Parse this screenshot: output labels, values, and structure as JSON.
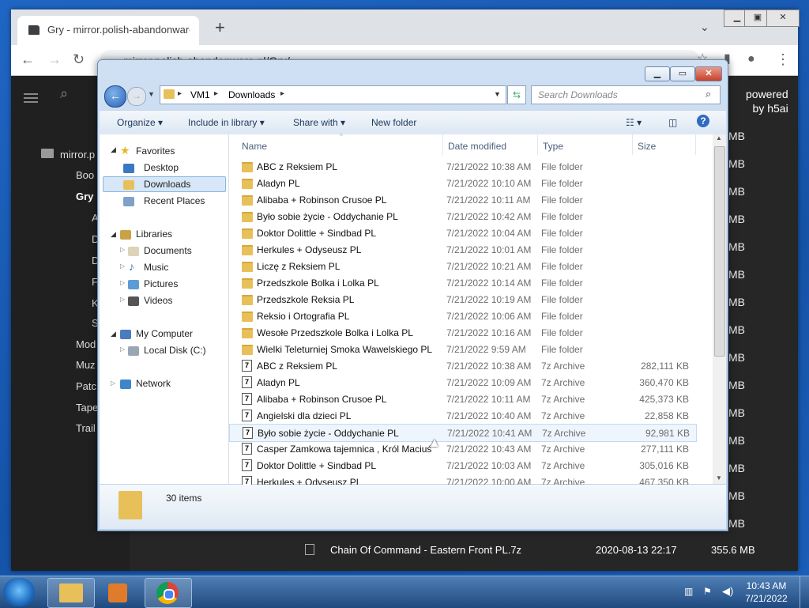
{
  "browser": {
    "tab_title": "Gry - mirror.polish-abandonware.pl/Gry/",
    "url": "mirror.polish-abandonware.pl/Gry/"
  },
  "page": {
    "powered_line1": "powered",
    "powered_line2": "by h5ai",
    "tree_root": "mirror.p",
    "tree_items": [
      "Boo",
      "Gry",
      "A",
      "D",
      "D",
      "F",
      "K",
      "S",
      "Mod",
      "Muz",
      "Patc",
      "Tape",
      "Trail"
    ],
    "size_unit": "MB",
    "bottom_row": {
      "name": "Chain Of Command - Eastern Front PL.7z",
      "date": "2020-08-13 22:17",
      "size": "355.6 MB"
    }
  },
  "explorer": {
    "breadcrumb": [
      "VM1",
      "Downloads"
    ],
    "search_placeholder": "Search Downloads",
    "commands": [
      "Organize",
      "Include in library",
      "Share with",
      "New folder"
    ],
    "nav": {
      "favorites": "Favorites",
      "desktop": "Desktop",
      "downloads": "Downloads",
      "recent": "Recent Places",
      "libraries": "Libraries",
      "documents": "Documents",
      "music": "Music",
      "pictures": "Pictures",
      "videos": "Videos",
      "computer": "My Computer",
      "localdisk": "Local Disk (C:)",
      "network": "Network"
    },
    "columns": {
      "name": "Name",
      "date": "Date modified",
      "type": "Type",
      "size": "Size"
    },
    "rows": [
      {
        "name": "ABC z Reksiem PL",
        "date": "7/21/2022 10:38 AM",
        "type": "File folder",
        "size": ""
      },
      {
        "name": "Aladyn PL",
        "date": "7/21/2022 10:10 AM",
        "type": "File folder",
        "size": ""
      },
      {
        "name": "Alibaba + Robinson Crusoe PL",
        "date": "7/21/2022 10:11 AM",
        "type": "File folder",
        "size": ""
      },
      {
        "name": "Było sobie życie - Oddychanie PL",
        "date": "7/21/2022 10:42 AM",
        "type": "File folder",
        "size": ""
      },
      {
        "name": "Doktor Dolittle + Sindbad PL",
        "date": "7/21/2022 10:04 AM",
        "type": "File folder",
        "size": ""
      },
      {
        "name": "Herkules + Odyseusz PL",
        "date": "7/21/2022 10:01 AM",
        "type": "File folder",
        "size": ""
      },
      {
        "name": "Liczę z Reksiem PL",
        "date": "7/21/2022 10:21 AM",
        "type": "File folder",
        "size": ""
      },
      {
        "name": "Przedszkole Bolka i Lolka PL",
        "date": "7/21/2022 10:14 AM",
        "type": "File folder",
        "size": ""
      },
      {
        "name": "Przedszkole Reksia PL",
        "date": "7/21/2022 10:19 AM",
        "type": "File folder",
        "size": ""
      },
      {
        "name": "Reksio i Ortografia PL",
        "date": "7/21/2022 10:06 AM",
        "type": "File folder",
        "size": ""
      },
      {
        "name": "Wesołe Przedszkole Bolka i Lolka PL",
        "date": "7/21/2022 10:16 AM",
        "type": "File folder",
        "size": ""
      },
      {
        "name": "Wielki Teleturniej Smoka Wawelskiego PL",
        "date": "7/21/2022 9:59 AM",
        "type": "File folder",
        "size": ""
      },
      {
        "name": "ABC z Reksiem PL",
        "date": "7/21/2022 10:38 AM",
        "type": "7z Archive",
        "size": "282,111 KB"
      },
      {
        "name": "Aladyn PL",
        "date": "7/21/2022 10:09 AM",
        "type": "7z Archive",
        "size": "360,470 KB"
      },
      {
        "name": "Alibaba + Robinson Crusoe PL",
        "date": "7/21/2022 10:11 AM",
        "type": "7z Archive",
        "size": "425,373 KB"
      },
      {
        "name": "Angielski dla dzieci PL",
        "date": "7/21/2022 10:40 AM",
        "type": "7z Archive",
        "size": "22,858 KB"
      },
      {
        "name": "Było sobie życie - Oddychanie PL",
        "date": "7/21/2022 10:41 AM",
        "type": "7z Archive",
        "size": "92,981 KB"
      },
      {
        "name": "Casper Zamkowa tajemnica , Król Maciuś",
        "date": "7/21/2022 10:43 AM",
        "type": "7z Archive",
        "size": "277,111 KB"
      },
      {
        "name": "Doktor Dolittle + Sindbad PL",
        "date": "7/21/2022 10:03 AM",
        "type": "7z Archive",
        "size": "305,016 KB"
      },
      {
        "name": "Herkules + Odyseusz PL",
        "date": "7/21/2022 10:00 AM",
        "type": "7z Archive",
        "size": "467,350 KB"
      }
    ],
    "item_count": "30 items"
  },
  "taskbar": {
    "time": "10:43 AM",
    "date": "7/21/2022"
  }
}
